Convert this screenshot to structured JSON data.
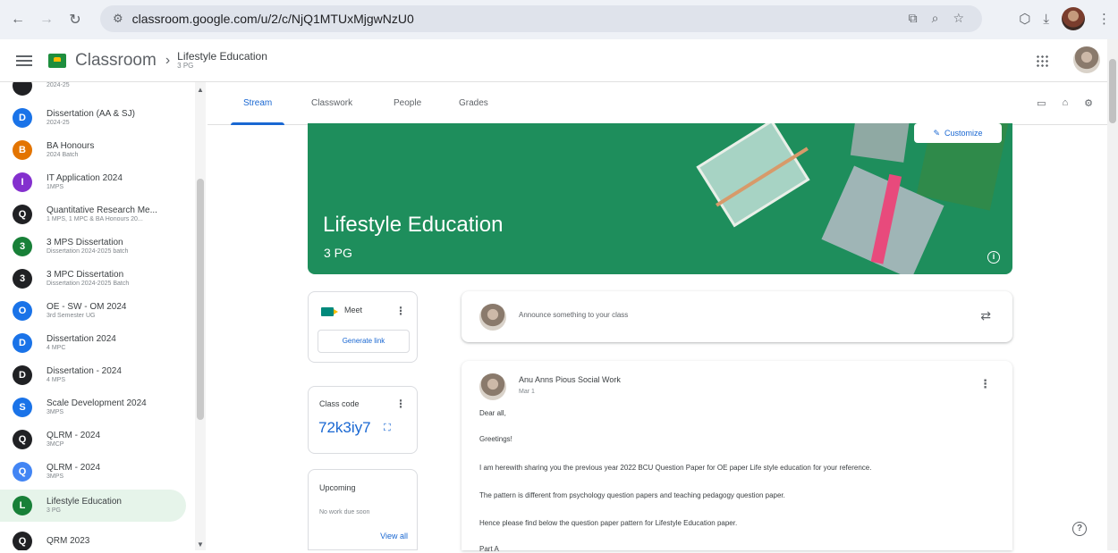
{
  "browser": {
    "url": "classroom.google.com/u/2/c/NjQ1MTUxMjgwNzU0"
  },
  "app": {
    "name": "Classroom",
    "breadcrumb_title": "Lifestyle Education",
    "breadcrumb_sub": "3 PG"
  },
  "sidebar": {
    "items": [
      {
        "name": "",
        "detail": "2024-25",
        "letter": "",
        "color": "#202124"
      },
      {
        "name": "Dissertation (AA & SJ)",
        "detail": "2024-25",
        "letter": "D",
        "color": "#1a73e8"
      },
      {
        "name": "BA Honours",
        "detail": "2024 Batch",
        "letter": "B",
        "color": "#e37400"
      },
      {
        "name": "IT Application 2024",
        "detail": "1MPS",
        "letter": "I",
        "color": "#8430ce"
      },
      {
        "name": "Quantitative Research Me...",
        "detail": "1 MPS, 1 MPC & BA Honours 20...",
        "letter": "Q",
        "color": "#202124"
      },
      {
        "name": "3 MPS Dissertation",
        "detail": "Dissertation 2024-2025 batch",
        "letter": "3",
        "color": "#188038"
      },
      {
        "name": "3 MPC Dissertation",
        "detail": "Dissertation 2024-2025 Batch",
        "letter": "3",
        "color": "#202124"
      },
      {
        "name": "OE - SW - OM 2024",
        "detail": "3rd Semester UG",
        "letter": "O",
        "color": "#1a73e8"
      },
      {
        "name": "Dissertation 2024",
        "detail": "4 MPC",
        "letter": "D",
        "color": "#1a73e8"
      },
      {
        "name": "Dissertation - 2024",
        "detail": "4 MPS",
        "letter": "D",
        "color": "#202124"
      },
      {
        "name": "Scale Development 2024",
        "detail": "3MPS",
        "letter": "S",
        "color": "#1a73e8"
      },
      {
        "name": "QLRM - 2024",
        "detail": "3MCP",
        "letter": "Q",
        "color": "#202124"
      },
      {
        "name": "QLRM - 2024",
        "detail": "3MPS",
        "letter": "Q",
        "color": "#4285f4"
      },
      {
        "name": "Lifestyle Education",
        "detail": "3 PG",
        "letter": "L",
        "color": "#188038"
      },
      {
        "name": "QRM 2023",
        "detail": "",
        "letter": "Q",
        "color": "#202124"
      }
    ]
  },
  "tabs": [
    "Stream",
    "Classwork",
    "People",
    "Grades"
  ],
  "banner": {
    "title": "Lifestyle Education",
    "section": "3 PG",
    "customize_label": "Customize"
  },
  "meet": {
    "label": "Meet",
    "generate_label": "Generate link"
  },
  "class_code": {
    "label": "Class code",
    "code": "72k3iy7"
  },
  "upcoming": {
    "label": "Upcoming",
    "empty": "No work due soon",
    "view_all": "View all"
  },
  "announce": {
    "placeholder": "Announce something to your class"
  },
  "post": {
    "author": "Anu Anns Pious Social Work",
    "date": "Mar 1",
    "lines": [
      "Dear all,",
      "Greetings!",
      "I am herewith sharing you the previous year 2022 BCU Question Paper for OE paper Life style education for your reference.",
      "The pattern is different from psychology question papers and teaching pedagogy question paper.",
      "Hence please find below the question paper pattern for Lifestyle Education paper.",
      "Part A"
    ]
  }
}
